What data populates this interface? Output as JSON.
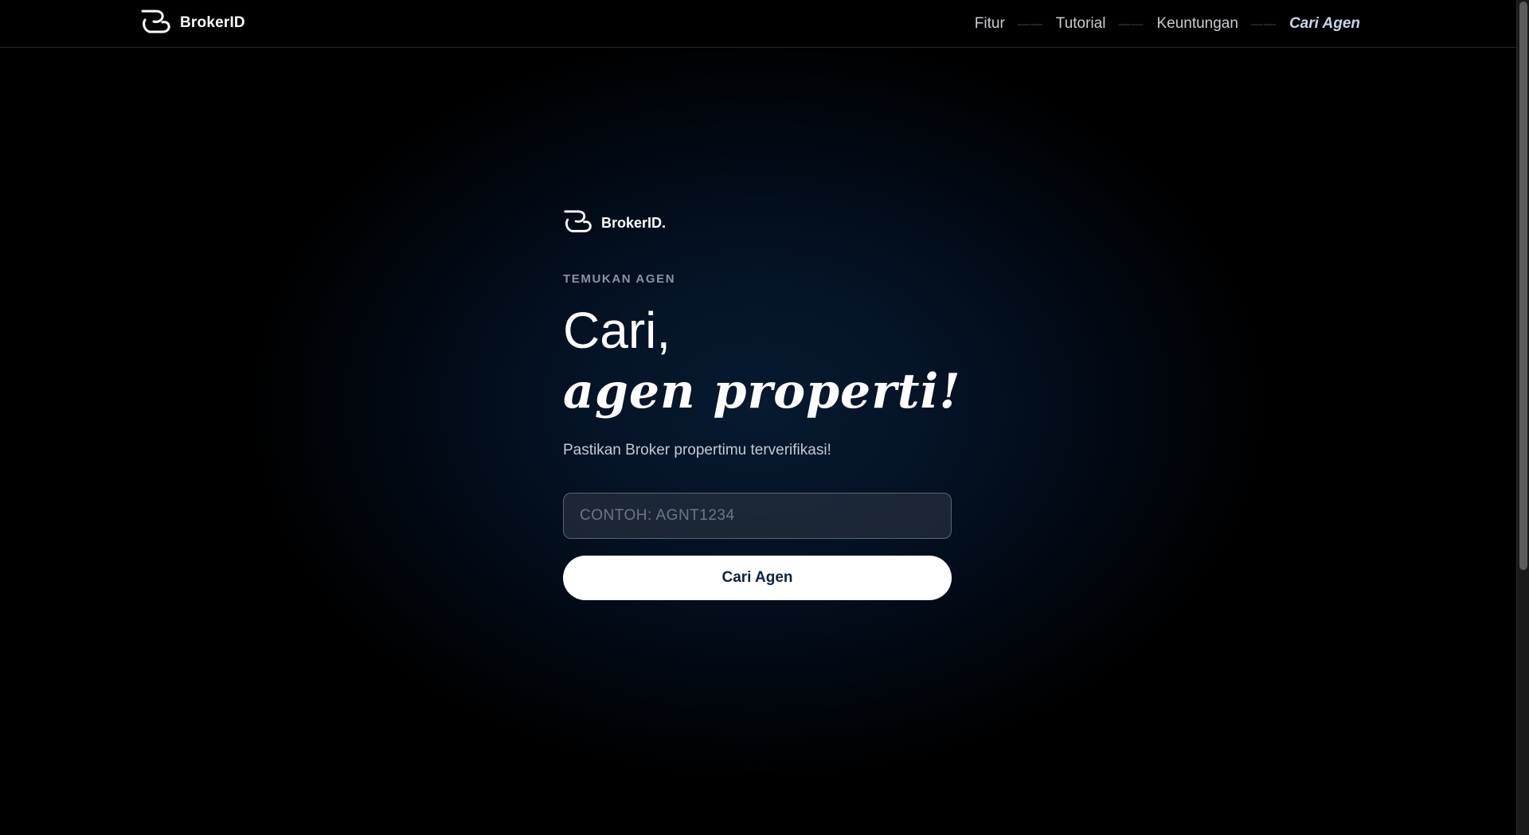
{
  "nav": {
    "brand_label": "BrokerID",
    "brand_icon": "brokerid-logo-icon",
    "links": [
      {
        "label": "Fitur"
      },
      {
        "label": "Tutorial"
      },
      {
        "label": "Keuntungan"
      },
      {
        "label": "Cari Agen",
        "active": true
      }
    ],
    "separator": "——"
  },
  "hero": {
    "logo_label": "BrokerID.",
    "logo_icon": "brokerid-logo-icon",
    "eyebrow": "TEMUKAN AGEN",
    "headline_line1": "Cari,",
    "headline_line2": "agen properti!",
    "subtitle": "Pastikan Broker propertimu terverifikasi!",
    "search": {
      "value": "",
      "placeholder": "CONTOH: AGNT1234"
    },
    "button_label": "Cari Agen"
  },
  "colors": {
    "background": "#000000",
    "glow": "#071a30",
    "button_text": "#0d2244",
    "active_nav": "#c8d3e8",
    "eyebrow": "#8a93a3"
  }
}
